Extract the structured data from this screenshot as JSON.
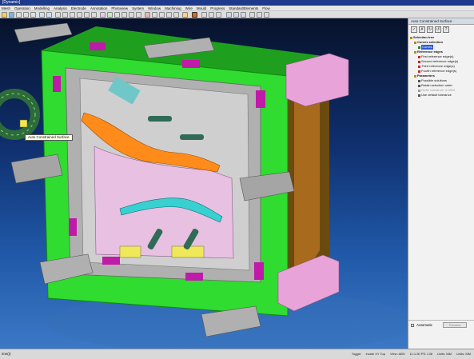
{
  "window": {
    "title": "[Dynamic]"
  },
  "menu": [
    "Mesh",
    "Operation",
    "Modelling",
    "Analysis",
    "Electrode",
    "Annotation",
    "Photoview",
    "System",
    "Window",
    "Machining",
    "Wire",
    "Mould",
    "Progress",
    "StandardElements",
    "Flow"
  ],
  "viewport": {
    "tooltip": "Auto Constrained Surface"
  },
  "panel": {
    "title": "Auto Constrained Surface",
    "icons": [
      "✓",
      "✗",
      "↻",
      "↺",
      "?"
    ],
    "tree": [
      {
        "label": "Selection tree",
        "level": 0,
        "bold": true,
        "color": "#b88a1a"
      },
      {
        "label": "Curves selection",
        "level": 1,
        "bold": true,
        "color": "#b88a1a"
      },
      {
        "label": "Curves",
        "level": 2,
        "bold": false,
        "color": "#2e7d32",
        "selected": true
      },
      {
        "label": "Reference edges",
        "level": 1,
        "bold": true,
        "color": "#b88a1a"
      },
      {
        "label": "First reference edge(s)",
        "level": 2,
        "bold": false,
        "color": "#c62828"
      },
      {
        "label": "Second reference edge(s)",
        "level": 2,
        "bold": false,
        "color": "#c62828"
      },
      {
        "label": "Third reference edge(s)",
        "level": 2,
        "bold": false,
        "color": "#c62828"
      },
      {
        "label": "Fourth reference edge(s)",
        "level": 2,
        "bold": false,
        "color": "#c62828"
      },
      {
        "label": "Parameters",
        "level": 1,
        "bold": true,
        "color": "#b88a1a"
      },
      {
        "label": "Possible solutions",
        "level": 2,
        "bold": false,
        "color": "#555555"
      },
      {
        "label": "Retain selection order",
        "level": 2,
        "bold": false,
        "color": "#555555"
      },
      {
        "label": "Order tolerance: 0.0010",
        "level": 2,
        "bold": false,
        "color": "#999999"
      },
      {
        "label": "Use default tolerance",
        "level": 2,
        "bold": false,
        "color": "#555555"
      }
    ],
    "automatic_label": "Automatic",
    "preview_label": "Preview"
  },
  "status": {
    "left": "ime(t)",
    "items": [
      "Toggle",
      "inside XY Top",
      "View: ABS",
      "11:1:30 PS: L38",
      "Units: MM",
      "Units: MM"
    ]
  },
  "colors": {
    "accent": "#1e3a8a",
    "green": "#2fdc2f",
    "pink": "#e8a3d8",
    "purple": "#c01aa8",
    "gray": "#a8a8a8",
    "orange": "#ff8c1a"
  }
}
